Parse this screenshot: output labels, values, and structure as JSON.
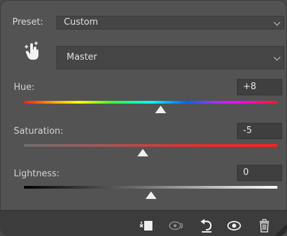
{
  "preset": {
    "label": "Preset:",
    "value": "Custom"
  },
  "channel": {
    "value": "Master"
  },
  "sliders": {
    "hue": {
      "label": "Hue:",
      "value": "+8",
      "position": 0.54
    },
    "saturation": {
      "label": "Saturation:",
      "value": "-5",
      "position": 0.47
    },
    "lightness": {
      "label": "Lightness:",
      "value": "0",
      "position": 0.5
    }
  },
  "toolbar": {
    "icons": [
      "clip-to-layer-icon",
      "view-previous-icon",
      "reset-icon",
      "visibility-eye-icon",
      "delete-trash-icon"
    ]
  },
  "colors": {
    "panel_bg": "#535353",
    "field_bg": "#454545",
    "saturation_track": "#e0302e"
  }
}
